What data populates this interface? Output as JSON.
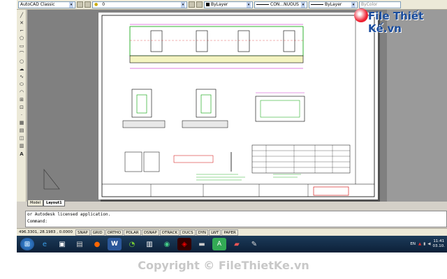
{
  "toolbar": {
    "workspace": "AutoCAD Classic",
    "layer": "0",
    "color": "ByLayer",
    "linetype": "CON...NUOUS",
    "lineweight": "ByLayer",
    "plotstyle": "ByColor"
  },
  "watermark": {
    "brand": "File Thiết Kế.vn",
    "copyright": "Copyright © FileThietKe.vn"
  },
  "tabs": [
    "Model",
    "Layout1"
  ],
  "command": {
    "history": "or Autodesk licensed application.",
    "prompt": "Command:"
  },
  "status": {
    "coords": "496.3301, 28.1983 , 0.0000",
    "buttons": [
      "SNAP",
      "GRID",
      "ORTHO",
      "POLAR",
      "OSNAP",
      "OTRACK",
      "DUCS",
      "DYN",
      "LWT",
      "PAPER"
    ]
  },
  "taskbar": {
    "lang": "EN",
    "time": "11:41",
    "date": "03.10."
  },
  "colors": {
    "accent": "#1a4d9e",
    "cad_magenta": "#c000c0",
    "cad_green": "#00a000",
    "cad_red": "#d00000"
  }
}
